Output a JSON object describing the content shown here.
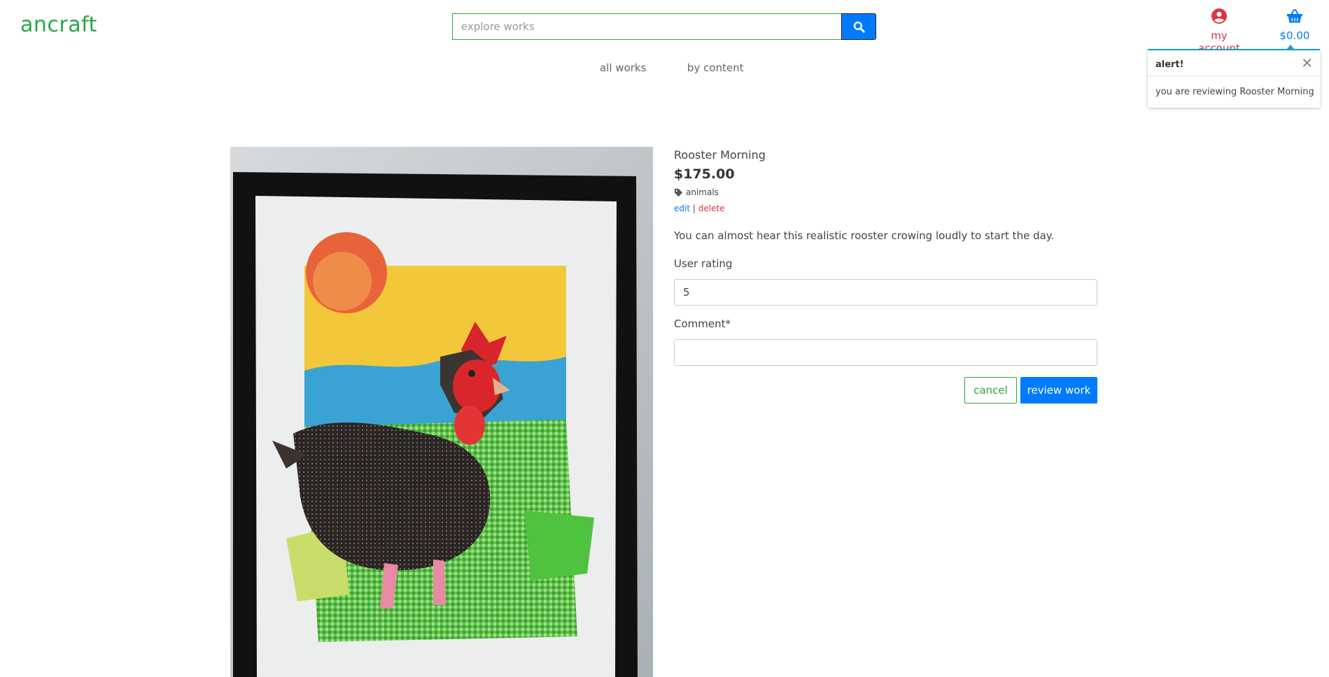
{
  "brand": {
    "logo_text": "ancraft"
  },
  "search": {
    "placeholder": "explore works",
    "value": "",
    "icon": "search-icon"
  },
  "header": {
    "account": {
      "label": "my account",
      "icon": "user-circle-icon",
      "color": "#dc3545"
    },
    "cart": {
      "label": "$0.00",
      "icon": "basket-icon",
      "color": "#007bff"
    }
  },
  "nav": {
    "items": [
      {
        "label": "all works"
      },
      {
        "label": "by content"
      }
    ]
  },
  "alert": {
    "title": "alert!",
    "message": "you are reviewing Rooster Morning",
    "close_icon": "close-icon",
    "accent": "#17a2b8"
  },
  "work": {
    "title": "Rooster Morning",
    "price": "$175.00",
    "tag": "animals",
    "tag_icon": "tag-icon",
    "edit_label": "edit",
    "separator": "|",
    "delete_label": "delete",
    "description": "You can almost hear this realistic rooster crowing loudly to start the day.",
    "image_subject": "framed collage of a rooster"
  },
  "form": {
    "rating_label": "User rating",
    "rating_value": "5",
    "comment_label": "Comment*",
    "comment_value": "",
    "cancel_label": "cancel",
    "submit_label": "review work"
  },
  "colors": {
    "brand_green": "#28a745",
    "primary_blue": "#007bff",
    "danger_red": "#dc3545"
  }
}
